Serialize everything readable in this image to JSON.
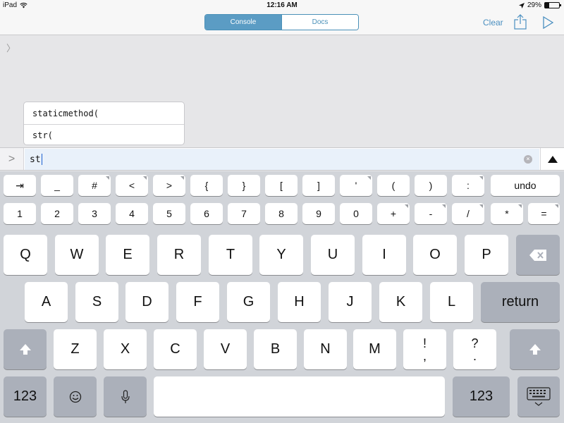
{
  "status_bar": {
    "device": "iPad",
    "time": "12:16 AM",
    "battery": "29%",
    "battery_level": 0.29
  },
  "navbar": {
    "tabs": [
      {
        "label": "Console",
        "active": true
      },
      {
        "label": "Docs",
        "active": false
      }
    ],
    "clear_label": "Clear"
  },
  "console": {
    "prompt_symbol": "〉",
    "completions": [
      "staticmethod(",
      "str("
    ]
  },
  "input": {
    "prompt": ">",
    "value": "st"
  },
  "keyboard": {
    "extra_row1": [
      "⇥",
      "_",
      "#",
      "<",
      ">",
      "{",
      "}",
      "[",
      "]",
      "'",
      "(",
      ")",
      ":",
      "undo"
    ],
    "extra_row2": [
      "1",
      "2",
      "3",
      "4",
      "5",
      "6",
      "7",
      "8",
      "9",
      "0",
      "+",
      "-",
      "/",
      "*",
      "="
    ],
    "row1": [
      "Q",
      "W",
      "E",
      "R",
      "T",
      "Y",
      "U",
      "I",
      "O",
      "P"
    ],
    "row2": [
      "A",
      "S",
      "D",
      "F",
      "G",
      "H",
      "J",
      "K",
      "L"
    ],
    "return_label": "return",
    "row3": [
      "Z",
      "X",
      "C",
      "V",
      "B",
      "N",
      "M"
    ],
    "punct1": {
      "top": "!",
      "bottom": ","
    },
    "punct2": {
      "top": "?",
      "bottom": "."
    },
    "numbers_label": "123"
  },
  "colors": {
    "accent": "#5b9cc4",
    "keyboard_bg": "#d1d4d9",
    "input_bg": "#e9f1fa"
  }
}
